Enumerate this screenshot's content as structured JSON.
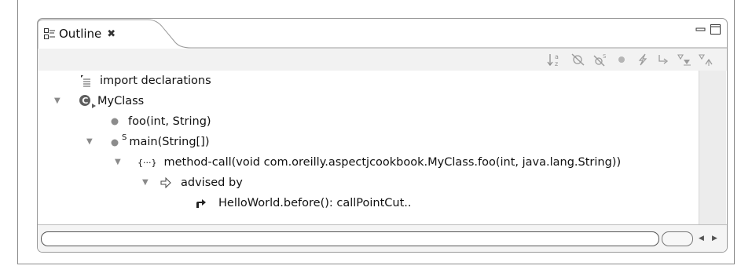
{
  "view": {
    "title": "Outline"
  },
  "toolbar_icons": [
    "sort-alphabetically-icon",
    "hide-fields-icon",
    "hide-static-icon",
    "hide-non-public-icon",
    "hide-advice-icon",
    "hide-pointcuts-icon",
    "collapse-all-icon",
    "link-with-editor-icon"
  ],
  "tree": {
    "import_declarations": "import declarations",
    "class_name": "MyClass",
    "method_foo": "foo(int, String)",
    "static_marker": "S",
    "method_main": "main(String[])",
    "method_call_icon": "{···}",
    "method_call": "method-call(void com.oreilly.aspectjcookbook.MyClass.foo(int, java.lang.String))",
    "advised_by": "advised by",
    "advice": "HelloWorld.before(): callPointCut.."
  },
  "colors": {
    "frame_border": "#8a8a8a",
    "toolbar_bg": "#f2f2f2",
    "tree_bg": "#ffffff",
    "scrollbar_bg": "#ececec",
    "icon_gray": "#9b9b9b"
  }
}
